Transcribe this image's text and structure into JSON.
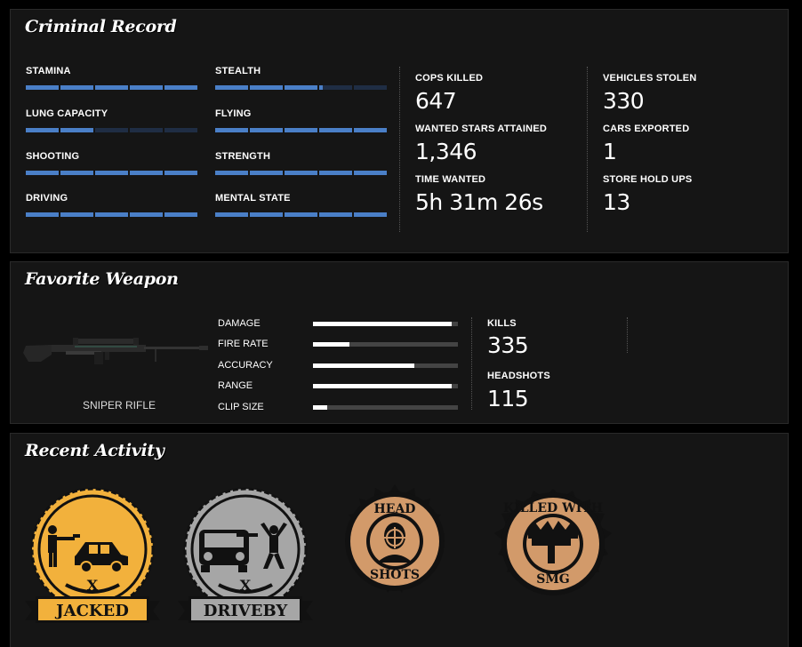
{
  "criminal_record": {
    "title": "Criminal Record",
    "skills": [
      {
        "label": "STAMINA",
        "level": 1.0
      },
      {
        "label": "STEALTH",
        "level": 0.62
      },
      {
        "label": "LUNG CAPACITY",
        "level": 0.4
      },
      {
        "label": "FLYING",
        "level": 1.0
      },
      {
        "label": "SHOOTING",
        "level": 1.0
      },
      {
        "label": "STRENGTH",
        "level": 1.0
      },
      {
        "label": "DRIVING",
        "level": 1.0
      },
      {
        "label": "MENTAL STATE",
        "level": 1.0
      }
    ],
    "stats": [
      {
        "label": "COPS KILLED",
        "value": "647"
      },
      {
        "label": "WANTED STARS ATTAINED",
        "value": "1,346"
      },
      {
        "label": "TIME WANTED",
        "value": "5h 31m 26s"
      },
      {
        "label": "VEHICLES STOLEN",
        "value": "330"
      },
      {
        "label": "CARS EXPORTED",
        "value": "1"
      },
      {
        "label": "STORE HOLD UPS",
        "value": "13"
      }
    ]
  },
  "favorite_weapon": {
    "title": "Favorite Weapon",
    "weapon_name": "SNIPER RIFLE",
    "attributes": [
      {
        "label": "DAMAGE",
        "level": 0.96
      },
      {
        "label": "FIRE RATE",
        "level": 0.25
      },
      {
        "label": "ACCURACY",
        "level": 0.7
      },
      {
        "label": "RANGE",
        "level": 0.96
      },
      {
        "label": "CLIP SIZE",
        "level": 0.1
      }
    ],
    "stats": [
      {
        "label": "KILLS",
        "value": "335"
      },
      {
        "label": "HEADSHOTS",
        "value": "115"
      }
    ]
  },
  "recent_activity": {
    "title": "Recent Activity",
    "badges": [
      {
        "label": "JACKED",
        "icon": "jacked-badge",
        "color": "#f2b13c"
      },
      {
        "label": "DRIVEBY",
        "icon": "driveby-badge",
        "color": "#a6a6a6"
      },
      {
        "top": "HEAD",
        "bottom": "SHOTS",
        "icon": "headshots-badge",
        "color": "#d29a6a"
      },
      {
        "top": "KILLED WITH",
        "bottom": "SMG",
        "icon": "killed-with-smg-badge",
        "color": "#d29a6a"
      }
    ]
  },
  "colors": {
    "skill_fill": "#4a7fc7",
    "skill_empty": "#1f2d44",
    "panel_bg": "#151515"
  }
}
